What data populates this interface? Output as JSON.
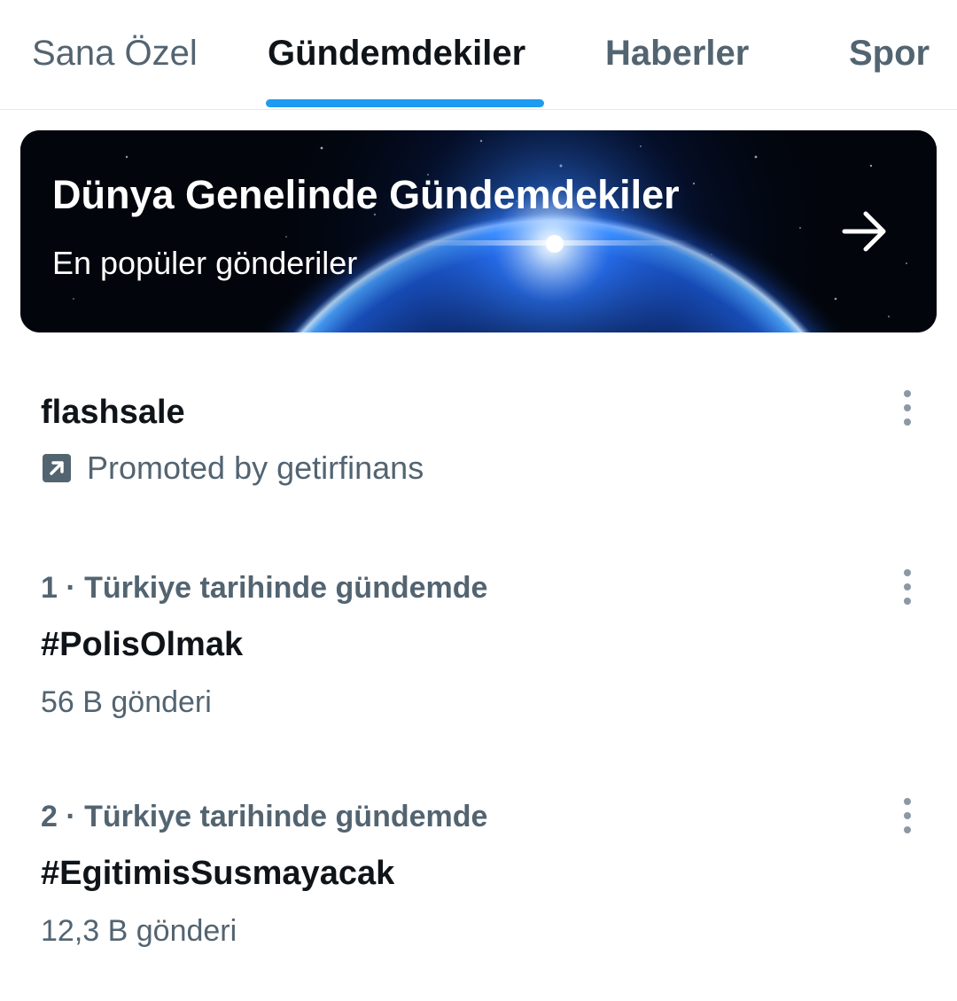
{
  "tabs": [
    {
      "label": "Sana Özel",
      "active": false
    },
    {
      "label": "Gündemdekiler",
      "active": true
    },
    {
      "label": "Haberler",
      "active": false
    },
    {
      "label": "Spor",
      "active": false
    }
  ],
  "banner": {
    "title": "Dünya Genelinde Gündemdekiler",
    "subtitle": "En popüler gönderiler",
    "arrow_icon": "arrow-right-icon"
  },
  "trends": [
    {
      "topic": "flashsale",
      "promoted_text": "Promoted by getirfinans",
      "promoted_icon": "promoted-icon",
      "more_icon": "more-vertical-icon"
    },
    {
      "meta": "1 · Türkiye tarihinde gündemde",
      "topic": "#PolisOlmak",
      "count": "56 B gönderi",
      "more_icon": "more-vertical-icon"
    },
    {
      "meta": "2 · Türkiye tarihinde gündemde",
      "topic": "#EgitimisSusmayacak",
      "count": "12,3 B gönderi",
      "more_icon": "more-vertical-icon"
    }
  ],
  "colors": {
    "accent": "#1d9bf0",
    "text_primary": "#0f1419",
    "text_secondary": "#536471"
  }
}
